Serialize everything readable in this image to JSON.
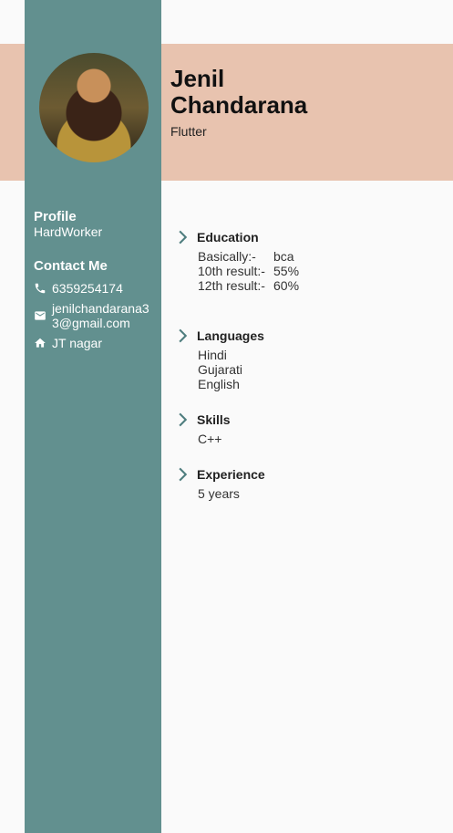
{
  "header": {
    "name_line1": "Jenil",
    "name_line2": "Chandarana",
    "role": "Flutter"
  },
  "sidebar": {
    "profile_title": "Profile",
    "profile_value": "HardWorker",
    "contact_title": "Contact Me",
    "contacts": [
      {
        "icon": "phone-icon",
        "text": "6359254174"
      },
      {
        "icon": "mail-icon",
        "text": "jenilchandarana3\n3@gmail.com",
        "line1": "jenilchandarana3",
        "line2": "3@gmail.com"
      },
      {
        "icon": "home-icon",
        "text": "JT nagar"
      }
    ]
  },
  "sections": {
    "education": {
      "title": "Education",
      "rows": [
        {
          "label": "Basically:-",
          "value": "bca"
        },
        {
          "label": "10th result:-",
          "value": "55%"
        },
        {
          "label": "12th result:-",
          "value": "60%"
        }
      ]
    },
    "languages": {
      "title": "Languages",
      "items": [
        "Hindi",
        "Gujarati",
        "English"
      ]
    },
    "skills": {
      "title": "Skills",
      "items": [
        "C++"
      ]
    },
    "experience": {
      "title": "Experience",
      "items": [
        "5 years"
      ]
    }
  },
  "colors": {
    "sidebar": "#62908f",
    "header_band": "#e8c3af",
    "background": "#fafafa"
  }
}
